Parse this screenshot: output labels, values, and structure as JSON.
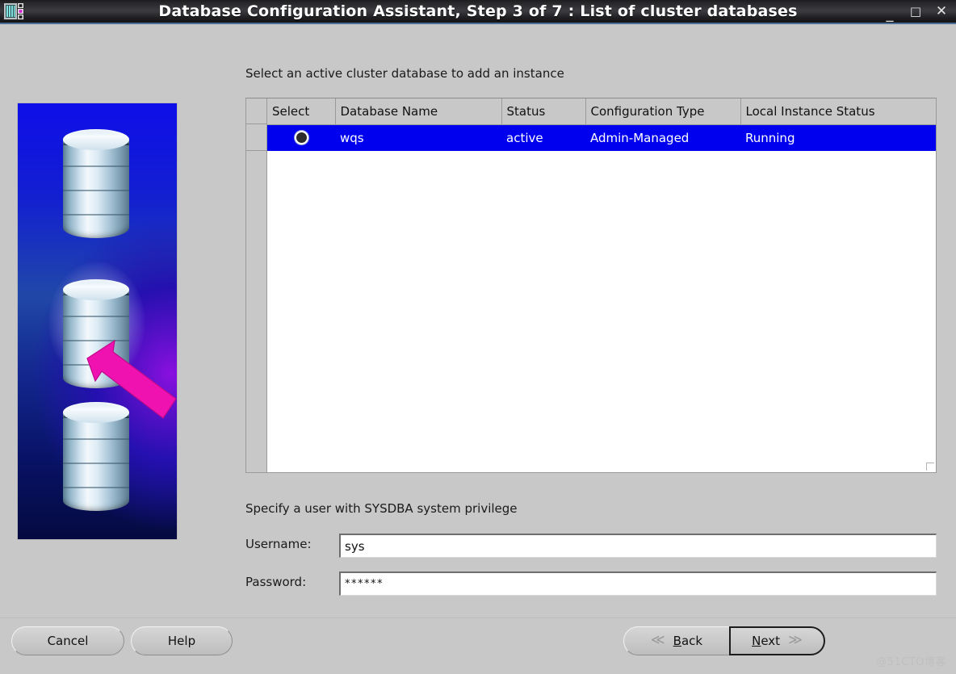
{
  "window": {
    "title": "Database Configuration Assistant, Step 3 of 7 : List of cluster databases",
    "icon": "oracle-dbca-icon",
    "controls": {
      "minimize": "_",
      "maximize": "□",
      "close": "✕"
    },
    "titlebar_bg": "#2b2b2f",
    "accent": "#4a6f94"
  },
  "banner": {
    "icon": "database-cylinders-graphic",
    "arrow": "magenta-arrow-icon",
    "gradient_from": "#0e0ee8",
    "gradient_to": "#8a10e0"
  },
  "main": {
    "instruction": "Select an active cluster database to add an instance",
    "table": {
      "columns": [
        "Select",
        "Database Name",
        "Status",
        "Configuration Type",
        "Local Instance Status"
      ],
      "rows": [
        {
          "select": "radio-selected",
          "database_name": "wqs",
          "status": "active",
          "configuration_type": "Admin-Managed",
          "local_instance_status": "Running",
          "selected": true
        }
      ],
      "selection_color": "#0000ee"
    },
    "credentials": {
      "section_label": "Specify a user with SYSDBA system privilege",
      "username_label": "Username:",
      "username_value": "sys",
      "username_placeholder": "",
      "password_label": "Password:",
      "password_value": "******",
      "password_placeholder": ""
    }
  },
  "footer": {
    "cancel_label": "Cancel",
    "help_label": "Help",
    "back_label": "Back",
    "back_mnemonic": "B",
    "back_rest": "ack",
    "next_label": "Next",
    "next_mnemonic": "N",
    "next_rest": "ext",
    "back_chevron": "≪",
    "next_chevron": "≫"
  },
  "watermark": "@51CTO博客"
}
